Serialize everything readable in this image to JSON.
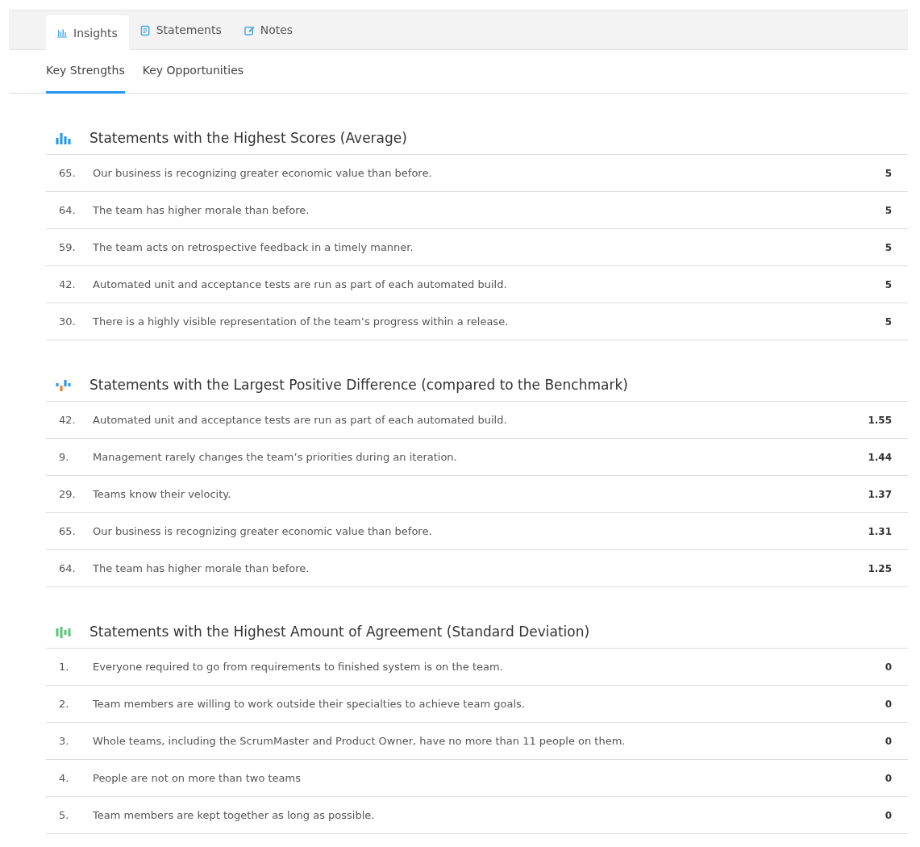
{
  "tabs": [
    {
      "label": "Insights",
      "kind": "bars",
      "selected": true
    },
    {
      "label": "Statements",
      "kind": "doc",
      "selected": false
    },
    {
      "label": "Notes",
      "kind": "edit",
      "selected": false
    }
  ],
  "subtabs": [
    {
      "label": "Key Strengths",
      "selected": true
    },
    {
      "label": "Key Opportunities",
      "selected": false
    }
  ],
  "sections": [
    {
      "kind": "scores",
      "title": "Statements with the Highest Scores (Average)",
      "rows": [
        {
          "number": "65.",
          "text": "Our business is recognizing greater economic value than before.",
          "value": "5"
        },
        {
          "number": "64.",
          "text": "The team has higher morale than before.",
          "value": "5"
        },
        {
          "number": "59.",
          "text": "The team acts on retrospective feedback in a timely manner.",
          "value": "5"
        },
        {
          "number": "42.",
          "text": "Automated unit and acceptance tests are run as part of each automated build.",
          "value": "5"
        },
        {
          "number": "30.",
          "text": "There is a highly visible representation of the team’s progress within a release.",
          "value": "5"
        }
      ]
    },
    {
      "kind": "difference",
      "title": "Statements with the Largest Positive Difference (compared to the Benchmark)",
      "rows": [
        {
          "number": "42.",
          "text": "Automated unit and acceptance tests are run as part of each automated build.",
          "value": "1.55"
        },
        {
          "number": "9.",
          "text": "Management rarely changes the team’s priorities during an iteration.",
          "value": "1.44"
        },
        {
          "number": "29.",
          "text": "Teams know their velocity.",
          "value": "1.37"
        },
        {
          "number": "65.",
          "text": "Our business is recognizing greater economic value than before.",
          "value": "1.31"
        },
        {
          "number": "64.",
          "text": "The team has higher morale than before.",
          "value": "1.25"
        }
      ]
    },
    {
      "kind": "agreement",
      "title": "Statements with the Highest Amount of Agreement (Standard Deviation)",
      "rows": [
        {
          "number": "1.",
          "text": "Everyone required to go from requirements to finished system is on the team.",
          "value": "0"
        },
        {
          "number": "2.",
          "text": "Team members are willing to work outside their specialties to achieve team goals.",
          "value": "0"
        },
        {
          "number": "3.",
          "text": "Whole teams, including the ScrumMaster and Product Owner, have no more than 11 people on them.",
          "value": "0"
        },
        {
          "number": "4.",
          "text": "People are not on more than two teams",
          "value": "0"
        },
        {
          "number": "5.",
          "text": "Team members are kept together as long as possible.",
          "value": "0"
        }
      ]
    }
  ]
}
